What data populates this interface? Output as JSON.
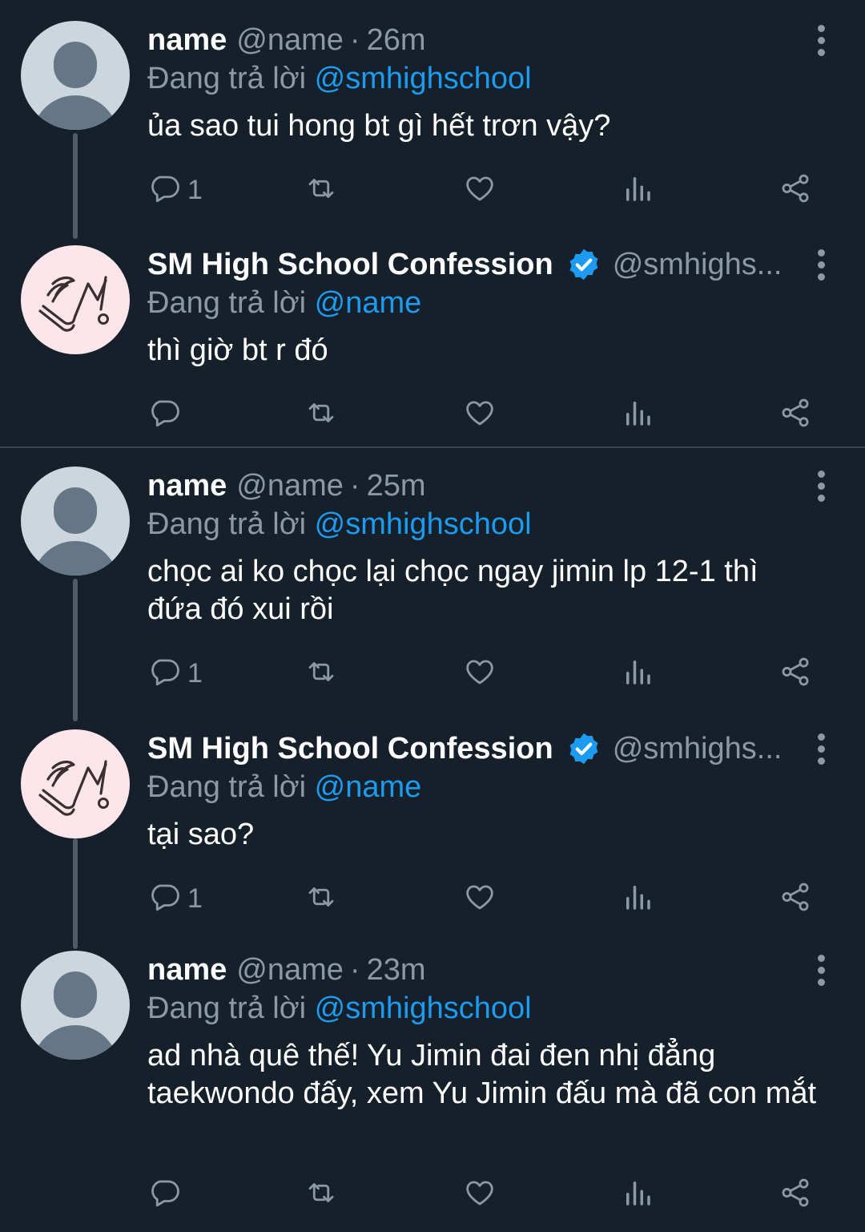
{
  "colors": {
    "background": "#15202b",
    "text_primary": "#ffffff",
    "text_secondary": "#8b98a5",
    "link": "#1d9bf0",
    "verified": "#1d9bf0"
  },
  "icons": {
    "reply": "reply-icon",
    "retweet": "retweet-icon",
    "like": "heart-icon",
    "views": "bar-chart-icon",
    "share": "share-icon",
    "more": "more-vertical-icon",
    "verified": "verified-badge-icon"
  },
  "tweets": [
    {
      "name": "name",
      "handle": "@name",
      "dot": "·",
      "time": "26m",
      "reply_label": "Đang trả lời",
      "reply_to": "@smhighschool",
      "text": "ủa sao tui hong bt gì hết trơn vậy?",
      "reply_count": "1"
    },
    {
      "name": "SM High School Confession",
      "handle": "@smhighs...",
      "reply_label": "Đang trả lời",
      "reply_to": "@name",
      "text": "thì giờ bt r đó",
      "reply_count": ""
    },
    {
      "name": "name",
      "handle": "@name",
      "dot": "·",
      "time": "25m",
      "reply_label": "Đang trả lời",
      "reply_to": "@smhighschool",
      "text": "chọc ai ko chọc lại chọc ngay jimin lp 12-1 thì đứa đó xui rồi",
      "reply_count": "1"
    },
    {
      "name": "SM High School Confession",
      "handle": "@smhighs...",
      "reply_label": "Đang trả lời",
      "reply_to": "@name",
      "text": "tại sao?",
      "reply_count": "1"
    },
    {
      "name": "name",
      "handle": "@name",
      "dot": "·",
      "time": "23m",
      "reply_label": "Đang trả lời",
      "reply_to": "@smhighschool",
      "text": "ad nhà quê thế! Yu Jimin đai đen nhị đẳng taekwondo đấy, xem Yu Jimin đấu mà đã con mắt",
      "reply_count": ""
    }
  ]
}
